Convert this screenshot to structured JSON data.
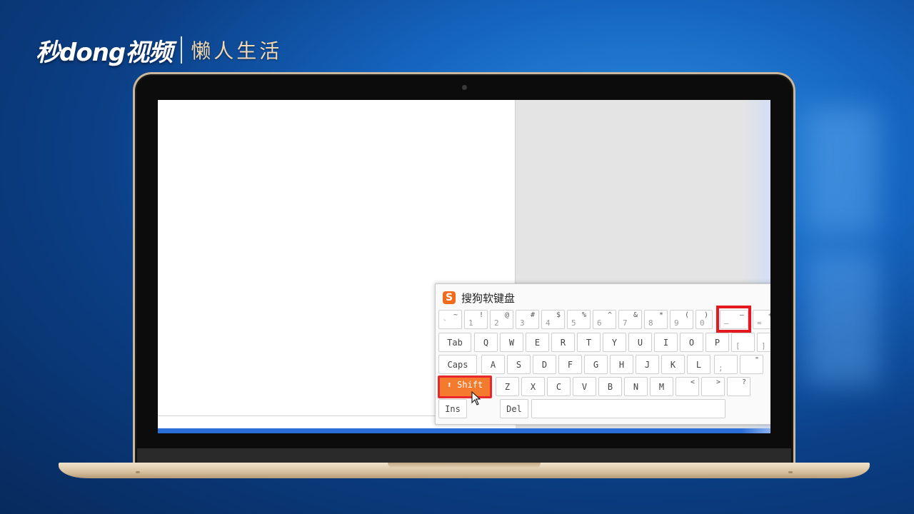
{
  "watermark": {
    "brand": "秒dong视频",
    "sub": "懒人生活"
  },
  "keyboard": {
    "title": "搜狗软键盘",
    "logo": "S",
    "row1": [
      {
        "top": "~",
        "bot": "`"
      },
      {
        "top": "!",
        "bot": "1"
      },
      {
        "top": "@",
        "bot": "2"
      },
      {
        "top": "#",
        "bot": "3"
      },
      {
        "top": "$",
        "bot": "4"
      },
      {
        "top": "%",
        "bot": "5"
      },
      {
        "top": "^",
        "bot": "6"
      },
      {
        "top": "&",
        "bot": "7"
      },
      {
        "top": "*",
        "bot": "8"
      },
      {
        "top": "(",
        "bot": "9"
      },
      {
        "top": ")",
        "bot": "0"
      },
      {
        "top": "—",
        "bot": "–"
      },
      {
        "top": "+",
        "bot": "="
      }
    ],
    "row2": [
      "Tab",
      "Q",
      "W",
      "E",
      "R",
      "T",
      "Y",
      "U",
      "I",
      "O",
      "P",
      "[",
      "]"
    ],
    "row3": [
      "Caps",
      "A",
      "S",
      "D",
      "F",
      "G",
      "H",
      "J",
      "K",
      "L",
      ";",
      "\""
    ],
    "row4": [
      "Shift",
      "Z",
      "X",
      "C",
      "V",
      "B",
      "N",
      "M",
      "<",
      ">",
      "?"
    ],
    "row5": [
      "Ins",
      "Del"
    ]
  },
  "colors": {
    "accent": "#f47a2e",
    "highlight": "#e3191f",
    "taskbar": "#2d6fd8"
  }
}
